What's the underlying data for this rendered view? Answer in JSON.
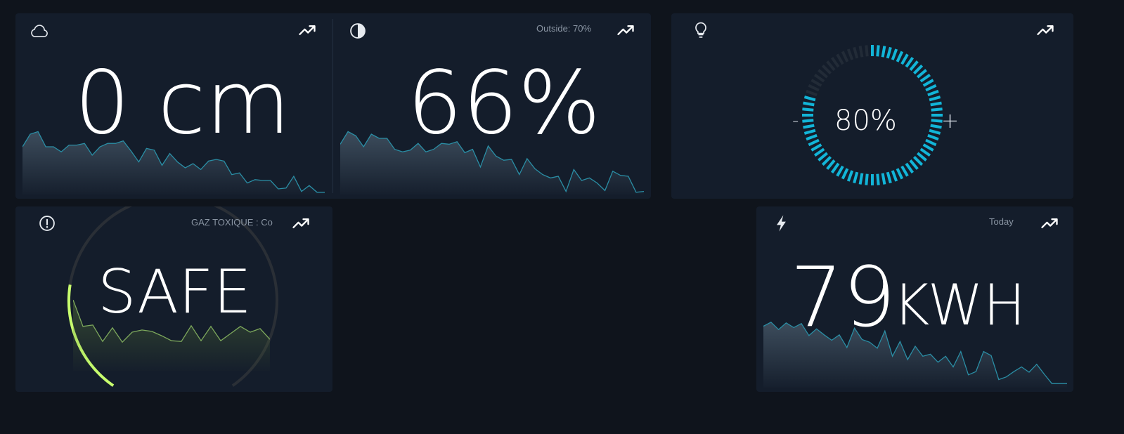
{
  "colors": {
    "background": "#0f141c",
    "card": "#141d2b",
    "sparkline_teal": "#2a8ea5",
    "gauge_cyan": "#12b5d8",
    "gas_green": "#c8ff6e",
    "gas_line": "#7da85c"
  },
  "cards": {
    "snow": {
      "icon": "cloud-icon",
      "value": "0 cm",
      "history": [
        0.55,
        0.7,
        0.73,
        0.55,
        0.55,
        0.49,
        0.57,
        0.57,
        0.59,
        0.45,
        0.55,
        0.59,
        0.59,
        0.62,
        0.5,
        0.37,
        0.53,
        0.51,
        0.33,
        0.47,
        0.37,
        0.3,
        0.35,
        0.28,
        0.38,
        0.4,
        0.38,
        0.22,
        0.24,
        0.12,
        0.16,
        0.15,
        0.15,
        0.05,
        0.06,
        0.2,
        0.02,
        0.09,
        0.01,
        0.01
      ]
    },
    "humidity": {
      "icon": "droplet-icon",
      "meta": "Outside: 70%",
      "value": "66%",
      "history": [
        0.58,
        0.73,
        0.68,
        0.55,
        0.7,
        0.65,
        0.65,
        0.52,
        0.49,
        0.51,
        0.59,
        0.49,
        0.52,
        0.59,
        0.58,
        0.61,
        0.48,
        0.52,
        0.31,
        0.56,
        0.44,
        0.39,
        0.4,
        0.22,
        0.41,
        0.29,
        0.22,
        0.18,
        0.2,
        0.02,
        0.28,
        0.15,
        0.18,
        0.12,
        0.03,
        0.26,
        0.21,
        0.2,
        0.01,
        0.02
      ]
    },
    "light": {
      "icon": "lightbulb-icon",
      "value": "80%",
      "level": 0.8,
      "minus_label": "-",
      "plus_label": "+"
    },
    "gas": {
      "icon": "alert-circle-icon",
      "meta": "GAZ TOXIQUE : Co",
      "value": "SAFE",
      "level": 0.22,
      "history": [
        0.97,
        0.6,
        0.62,
        0.39,
        0.58,
        0.38,
        0.52,
        0.55,
        0.53,
        0.47,
        0.4,
        0.39,
        0.61,
        0.4,
        0.6,
        0.4,
        0.5,
        0.6,
        0.52,
        0.57,
        0.42
      ]
    },
    "energy": {
      "icon": "lightning-icon",
      "meta": "Today",
      "value": "79",
      "unit": "KWH",
      "history": [
        0.9,
        0.96,
        0.85,
        0.95,
        0.88,
        0.94,
        0.76,
        0.86,
        0.77,
        0.69,
        0.77,
        0.58,
        0.87,
        0.7,
        0.66,
        0.57,
        0.83,
        0.45,
        0.67,
        0.4,
        0.6,
        0.45,
        0.48,
        0.36,
        0.45,
        0.29,
        0.52,
        0.17,
        0.22,
        0.52,
        0.46,
        0.1,
        0.14,
        0.22,
        0.29,
        0.21,
        0.33,
        0.18,
        0.04,
        0.04,
        0.04
      ]
    }
  }
}
